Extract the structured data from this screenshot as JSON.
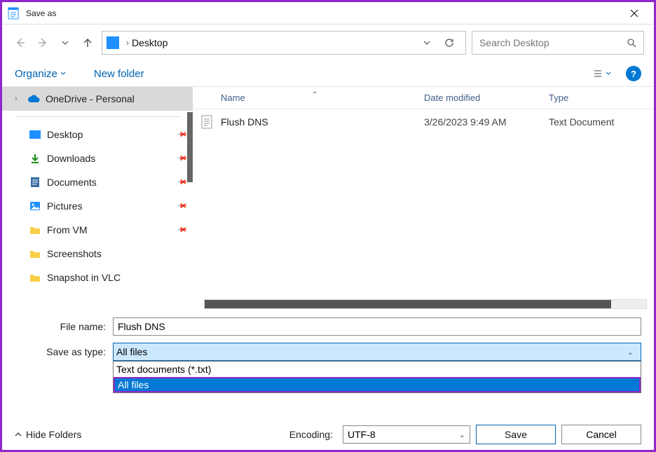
{
  "window": {
    "title": "Save as"
  },
  "breadcrumb": {
    "location": "Desktop"
  },
  "search": {
    "placeholder": "Search Desktop"
  },
  "toolbar": {
    "organize": "Organize",
    "new_folder": "New folder"
  },
  "sidebar": {
    "onedrive": "OneDrive - Personal",
    "items": [
      "Desktop",
      "Downloads",
      "Documents",
      "Pictures",
      "From VM",
      "Screenshots",
      "Snapshot in VLC"
    ]
  },
  "columns": {
    "name": "Name",
    "date": "Date modified",
    "type": "Type"
  },
  "files": [
    {
      "name": "Flush DNS",
      "date": "3/26/2023 9:49 AM",
      "type": "Text Document"
    }
  ],
  "form": {
    "file_name_label": "File name:",
    "file_name_value": "Flush DNS",
    "save_type_label": "Save as type:",
    "save_type_value": "All files",
    "type_options": [
      "Text documents (*.txt)",
      "All files"
    ]
  },
  "bottom": {
    "hide_folders": "Hide Folders",
    "encoding_label": "Encoding:",
    "encoding_value": "UTF-8",
    "save": "Save",
    "cancel": "Cancel"
  }
}
